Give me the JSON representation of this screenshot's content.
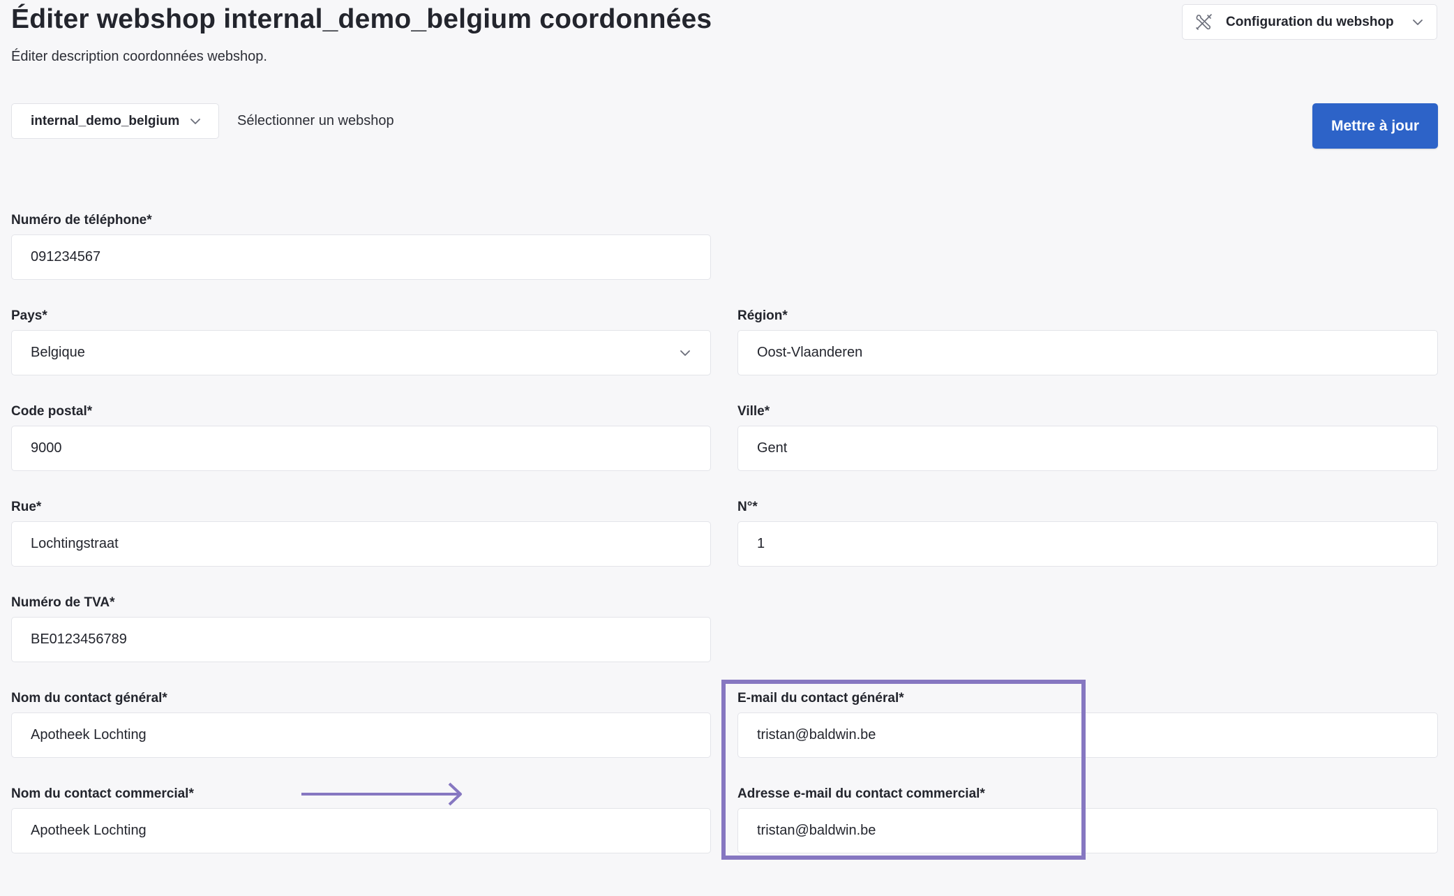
{
  "header": {
    "title": "Éditer webshop internal_demo_belgium coordonnées",
    "subtitle": "Éditer description coordonnées webshop.",
    "config_dropdown_label": "Configuration du webshop"
  },
  "toolbar": {
    "webshop_selected": "internal_demo_belgium",
    "webshop_hint": "Sélectionner un webshop",
    "update_label": "Mettre à jour"
  },
  "form": {
    "phone": {
      "label": "Numéro de téléphone*",
      "value": "091234567"
    },
    "country": {
      "label": "Pays*",
      "value": "Belgique"
    },
    "region": {
      "label": "Région*",
      "value": "Oost-Vlaanderen"
    },
    "postal_code": {
      "label": "Code postal*",
      "value": "9000"
    },
    "city": {
      "label": "Ville*",
      "value": "Gent"
    },
    "street": {
      "label": "Rue*",
      "value": "Lochtingstraat"
    },
    "number": {
      "label": "N°*",
      "value": "1"
    },
    "vat": {
      "label": "Numéro de TVA*",
      "value": "BE0123456789"
    },
    "general_contact_name": {
      "label": "Nom du contact général*",
      "value": "Apotheek Lochting"
    },
    "general_contact_email": {
      "label": "E-mail du contact général*",
      "value": "tristan@baldwin.be"
    },
    "commercial_contact_name": {
      "label": "Nom du contact commercial*",
      "value": "Apotheek Lochting"
    },
    "commercial_contact_email": {
      "label": "Adresse e-mail du contact commercial*",
      "value": "tristan@baldwin.be"
    }
  },
  "annotation": {
    "highlight_color": "#8677c1"
  },
  "colors": {
    "primary": "#2d63c8",
    "background": "#f7f7f9"
  }
}
